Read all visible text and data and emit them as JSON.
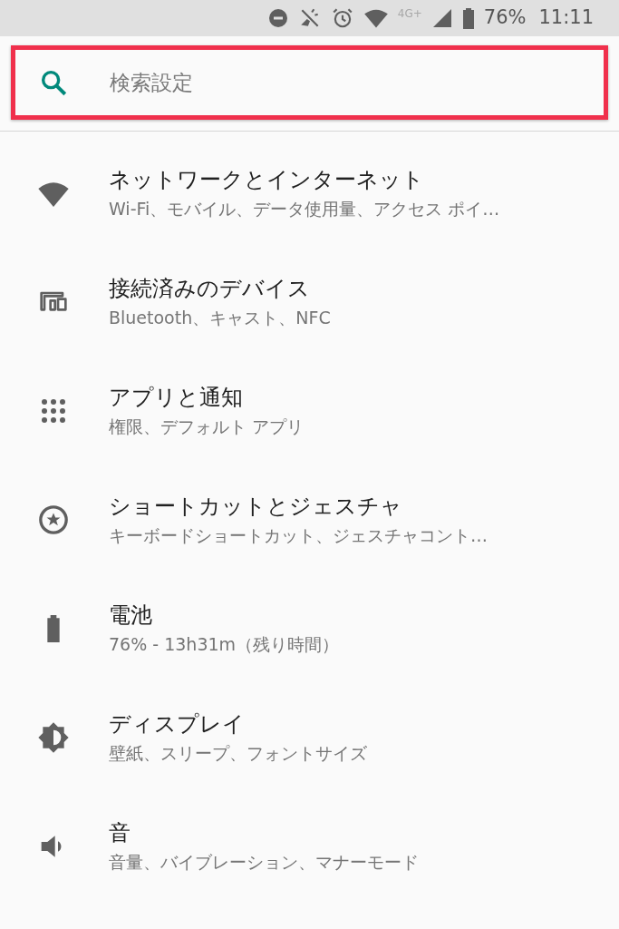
{
  "status_bar": {
    "network_type": "4G+",
    "battery": "76%",
    "time": "11:11"
  },
  "search": {
    "placeholder": "検索設定",
    "highlighted": true
  },
  "settings": [
    {
      "kind": "network",
      "title": "ネットワークとインターネット",
      "subtitle": "Wi-Fi、モバイル、データ使用量、アクセス ポイ…"
    },
    {
      "kind": "devices",
      "title": "接続済みのデバイス",
      "subtitle": "Bluetooth、キャスト、NFC"
    },
    {
      "kind": "apps",
      "title": "アプリと通知",
      "subtitle": "権限、デフォルト アプリ"
    },
    {
      "kind": "shortcuts",
      "title": "ショートカットとジェスチャ",
      "subtitle": "キーボードショートカット、ジェスチャコント…"
    },
    {
      "kind": "battery",
      "title": "電池",
      "subtitle": "76% - 13h31m（残り時間）"
    },
    {
      "kind": "display",
      "title": "ディスプレイ",
      "subtitle": "壁紙、スリープ、フォントサイズ"
    },
    {
      "kind": "sound",
      "title": "音",
      "subtitle": "音量、バイブレーション、マナーモード"
    }
  ]
}
